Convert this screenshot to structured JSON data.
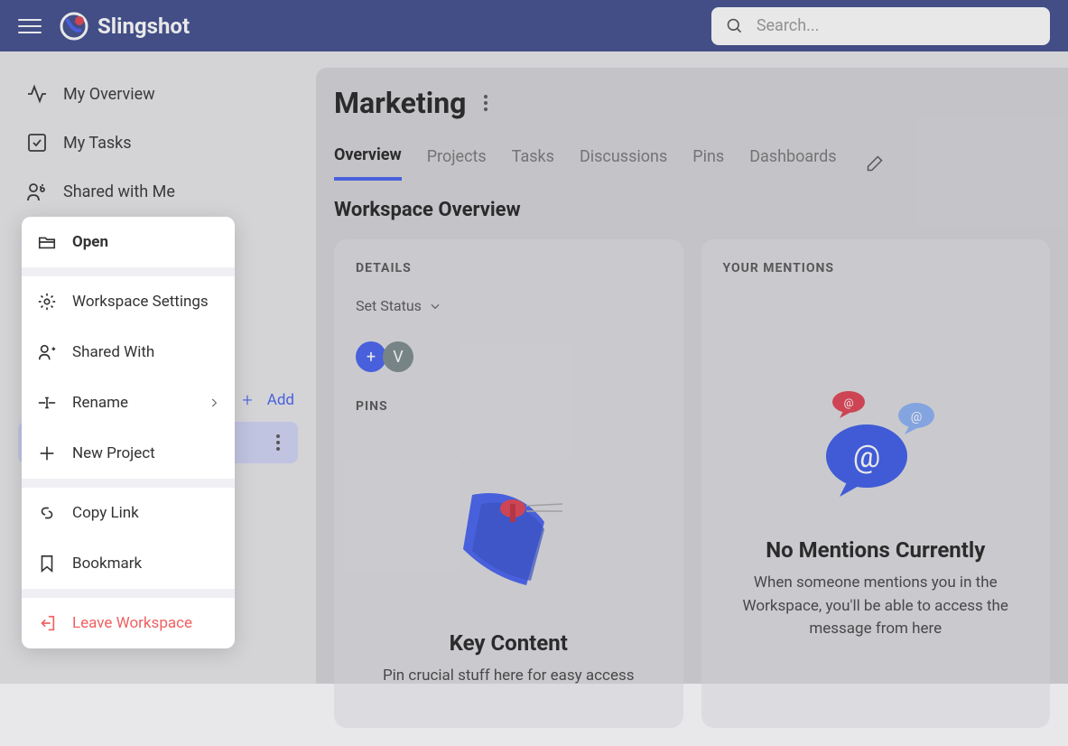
{
  "header": {
    "brand": "Slingshot",
    "search_placeholder": "Search..."
  },
  "sidebar": {
    "items": [
      {
        "label": "My Overview"
      },
      {
        "label": "My Tasks"
      },
      {
        "label": "Shared with Me"
      }
    ],
    "workspaces_add": "Add"
  },
  "context_menu": {
    "open": "Open",
    "settings": "Workspace Settings",
    "shared": "Shared With",
    "rename": "Rename",
    "new_project": "New Project",
    "copy_link": "Copy Link",
    "bookmark": "Bookmark",
    "leave": "Leave Workspace"
  },
  "main": {
    "title": "Marketing",
    "tabs": [
      {
        "label": "Overview",
        "active": true
      },
      {
        "label": "Projects"
      },
      {
        "label": "Tasks"
      },
      {
        "label": "Discussions"
      },
      {
        "label": "Pins"
      },
      {
        "label": "Dashboards"
      }
    ],
    "section_title": "Workspace Overview"
  },
  "details_card": {
    "header": "DETAILS",
    "status_label": "Set Status",
    "avatar_add": "+",
    "avatar_user": "V",
    "pins_label": "PINS",
    "empty_title": "Key Content",
    "empty_text": "Pin crucial stuff here for easy access"
  },
  "mentions_card": {
    "header": "YOUR MENTIONS",
    "empty_title": "No Mentions Currently",
    "empty_text": "When someone mentions you in the Workspace, you'll be able to access the message from here"
  }
}
